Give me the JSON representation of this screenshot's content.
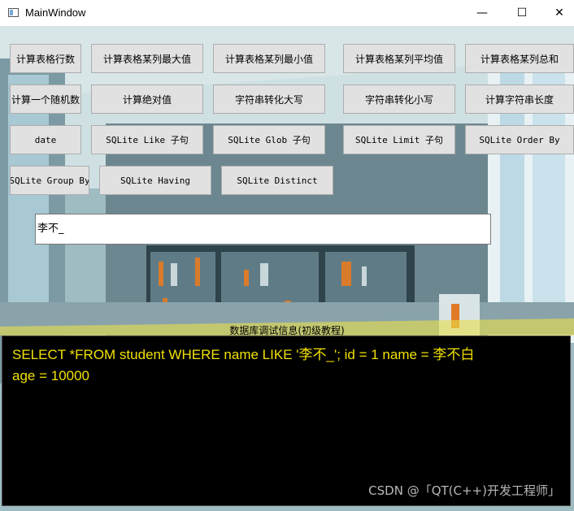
{
  "window": {
    "title": "MainWindow",
    "minimize_glyph": "—",
    "maximize_glyph": "☐",
    "close_glyph": "✕"
  },
  "buttons": [
    "计算表格行数",
    "计算表格某列最大值",
    "计算表格某列最小值",
    "计算表格某列平均值",
    "计算表格某列总和",
    "计算一个随机数",
    "计算绝对值",
    "字符串转化大写",
    "字符串转化小写",
    "计算字符串长度",
    "date",
    "SQLite Like 子句",
    "SQLite Glob 子句",
    "SQLite Limit 子句",
    "SQLite Order By",
    "SQLite Group By",
    "SQLite Having",
    "SQLite Distinct"
  ],
  "input": {
    "value": "李不_"
  },
  "console": {
    "title": "数据库调试信息(初级教程)",
    "line1": "SELECT *FROM student WHERE name LIKE '李不_';   id = 1 name = 李不白",
    "line2": "age = 10000"
  },
  "watermark": "CSDN @「QT(C++)开发工程师」",
  "colors": {
    "console_bg": "#000000",
    "console_text": "#f0e000",
    "button_bg": "#e1e1e1"
  },
  "icons": {
    "app": "window-icon",
    "minimize": "minimize-icon",
    "maximize": "maximize-icon",
    "close": "close-icon"
  }
}
